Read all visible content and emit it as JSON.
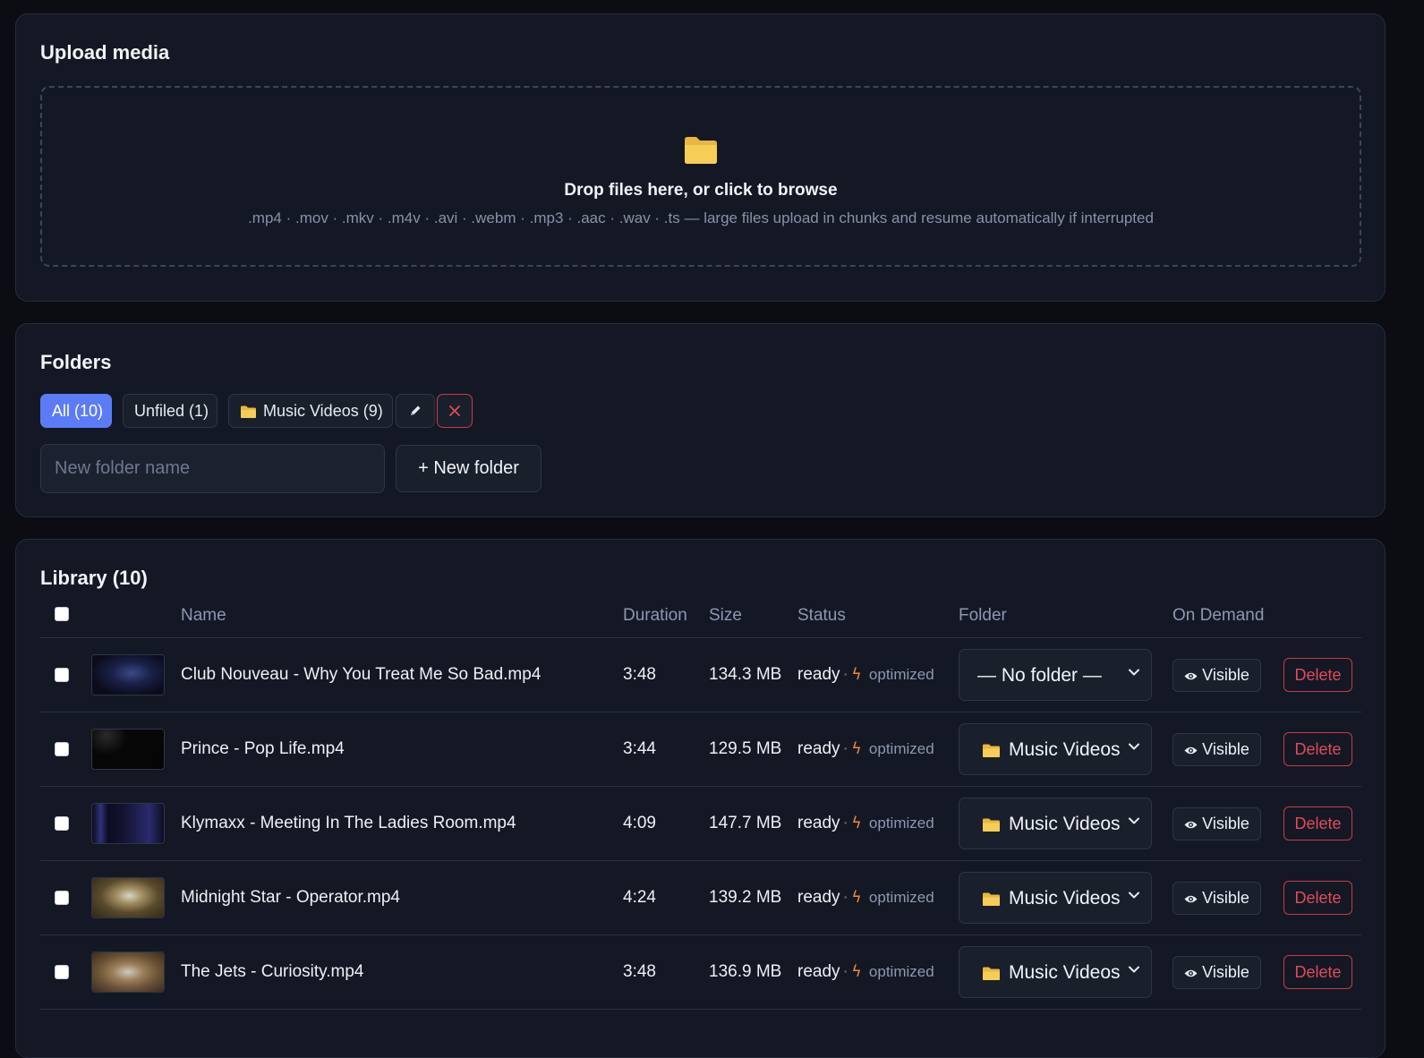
{
  "upload": {
    "title": "Upload media",
    "dropzone_title": "Drop files here, or click to browse",
    "dropzone_hint": ".mp4 · .mov · .mkv · .m4v · .avi · .webm · .mp3 · .aac · .wav · .ts — large files upload in chunks and resume automatically if interrupted",
    "icon": "folder-icon"
  },
  "folders": {
    "title": "Folders",
    "chips": [
      {
        "label": "All (10)",
        "active": true
      },
      {
        "label": "Unfiled (1)",
        "active": false
      },
      {
        "label": "Music Videos (9)",
        "active": false,
        "icon": "folder-icon"
      }
    ],
    "rename_icon": "pencil-icon",
    "delete_icon": "close-icon",
    "new_folder_placeholder": "New folder name",
    "new_folder_button": "+ New folder"
  },
  "library": {
    "title": "Library (10)",
    "columns": {
      "name": "Name",
      "duration": "Duration",
      "size": "Size",
      "status": "Status",
      "folder": "Folder",
      "on_demand": "On Demand"
    },
    "rows": [
      {
        "name": "Club Nouveau - Why You Treat Me So Bad.mp4",
        "duration": "3:48",
        "size": "134.3 MB",
        "status": "ready",
        "status_separator": "·",
        "optimized": "optimized",
        "folder": "— No folder —",
        "folder_icon": false,
        "visibility": "Visible",
        "delete": "Delete"
      },
      {
        "name": "Prince - Pop Life.mp4",
        "duration": "3:44",
        "size": "129.5 MB",
        "status": "ready",
        "status_separator": "·",
        "optimized": "optimized",
        "folder": "Music Videos",
        "folder_icon": true,
        "visibility": "Visible",
        "delete": "Delete"
      },
      {
        "name": "Klymaxx - Meeting In The Ladies Room.mp4",
        "duration": "4:09",
        "size": "147.7 MB",
        "status": "ready",
        "status_separator": "·",
        "optimized": "optimized",
        "folder": "Music Videos",
        "folder_icon": true,
        "visibility": "Visible",
        "delete": "Delete"
      },
      {
        "name": "Midnight Star - Operator.mp4",
        "duration": "4:24",
        "size": "139.2 MB",
        "status": "ready",
        "status_separator": "·",
        "optimized": "optimized",
        "folder": "Music Videos",
        "folder_icon": true,
        "visibility": "Visible",
        "delete": "Delete"
      },
      {
        "name": "The Jets - Curiosity.mp4",
        "duration": "3:48",
        "size": "136.9 MB",
        "status": "ready",
        "status_separator": "·",
        "optimized": "optimized",
        "folder": "Music Videos",
        "folder_icon": true,
        "visibility": "Visible",
        "delete": "Delete"
      }
    ]
  },
  "colors": {
    "accent": "#5b7cf6",
    "danger": "#e04b59",
    "optimized_bolt": "#f0883e",
    "folder_icon": "#f5c84c",
    "background": "#0b0d13",
    "panel": "#141824"
  }
}
